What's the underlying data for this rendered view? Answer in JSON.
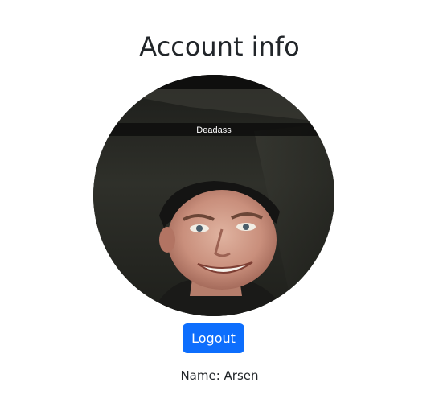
{
  "page": {
    "title": "Account info"
  },
  "avatar": {
    "caption": "Deadass",
    "description": "profile-photo"
  },
  "actions": {
    "logout_label": "Logout"
  },
  "profile": {
    "name_label": "Name:",
    "name_value": "Arsen"
  },
  "colors": {
    "primary": "#0d6efd",
    "text": "#212529",
    "background": "#ffffff"
  }
}
